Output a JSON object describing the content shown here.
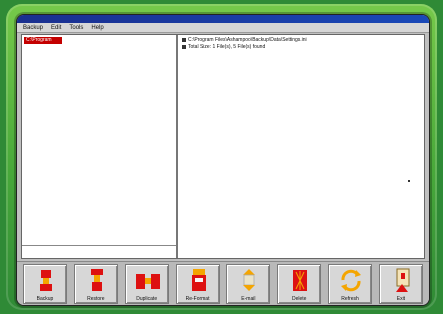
{
  "window": {
    "menu": [
      "Backup",
      "Edit",
      "Tools",
      "Help"
    ]
  },
  "left_pane": {
    "selected_item": "C:\\Program"
  },
  "right_pane": {
    "paths": [
      "C:\\Program Files\\Ashampoo\\Backup\\Data\\Settings.ini",
      "Total Size: 1 File(s), 5 File(s) found"
    ]
  },
  "toolbar": {
    "buttons": [
      {
        "label": "Backup",
        "icon": "backup-icon"
      },
      {
        "label": "Restore",
        "icon": "restore-icon"
      },
      {
        "label": "Duplicate",
        "icon": "duplicate-icon"
      },
      {
        "label": "Re-Format",
        "icon": "reformat-icon"
      },
      {
        "label": "E-mail",
        "icon": "email-icon"
      },
      {
        "label": "Delete",
        "icon": "delete-icon"
      },
      {
        "label": "Refresh",
        "icon": "refresh-icon"
      },
      {
        "label": "Exit",
        "icon": "exit-icon"
      }
    ]
  },
  "colors": {
    "frame_green": "#48a83a",
    "accent_red": "#c40000",
    "titlebar_blue": "#1a2f8f"
  }
}
